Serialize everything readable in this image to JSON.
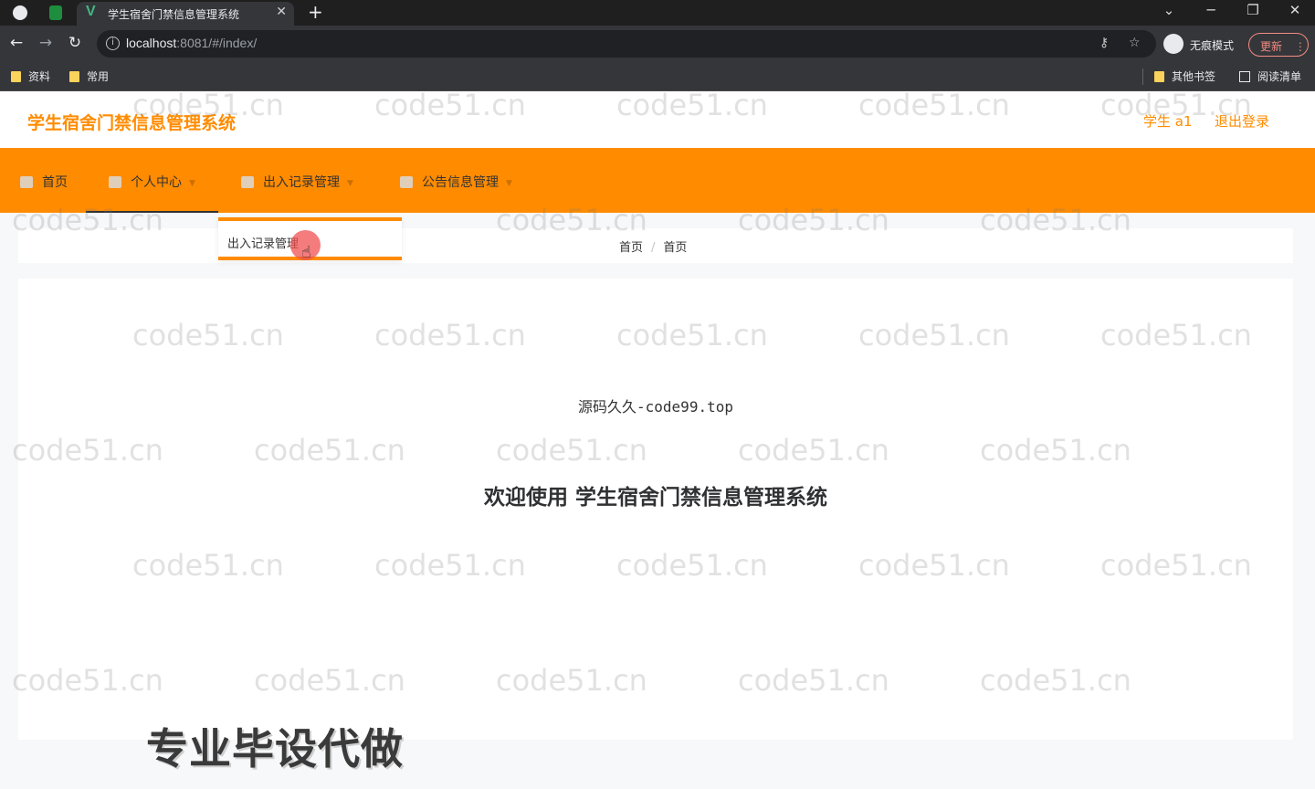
{
  "browser": {
    "tab_title": "学生宿舍门禁信息管理系统",
    "url_host": "localhost",
    "url_rest": ":8081/#/index/",
    "incognito_label": "无痕模式",
    "update_label": "更新",
    "bookmarks": [
      "资料",
      "常用"
    ],
    "bookmarks_right": [
      "其他书签",
      "阅读清单"
    ]
  },
  "header": {
    "title": "学生宿舍门禁信息管理系统",
    "user": "学生 a1",
    "logout": "退出登录"
  },
  "nav": {
    "items": [
      {
        "label": "首页",
        "icon": "home-icon"
      },
      {
        "label": "个人中心",
        "icon": "user-icon"
      },
      {
        "label": "出入记录管理",
        "icon": "grid-icon"
      },
      {
        "label": "公告信息管理",
        "icon": "notice-icon"
      }
    ],
    "active": "个人中心",
    "dropdown_item": "出入记录管理"
  },
  "breadcrumb": [
    "首页",
    "首页"
  ],
  "main": {
    "tagline": "源码久久-code99.top",
    "welcome": "欢迎使用 学生宿舍门禁信息管理系统"
  },
  "overlay": {
    "promo": "专业毕设代做",
    "watermark": "code51.cn"
  },
  "colors": {
    "brand": "#ff8c00",
    "nav_bg": "#ff8b00"
  }
}
